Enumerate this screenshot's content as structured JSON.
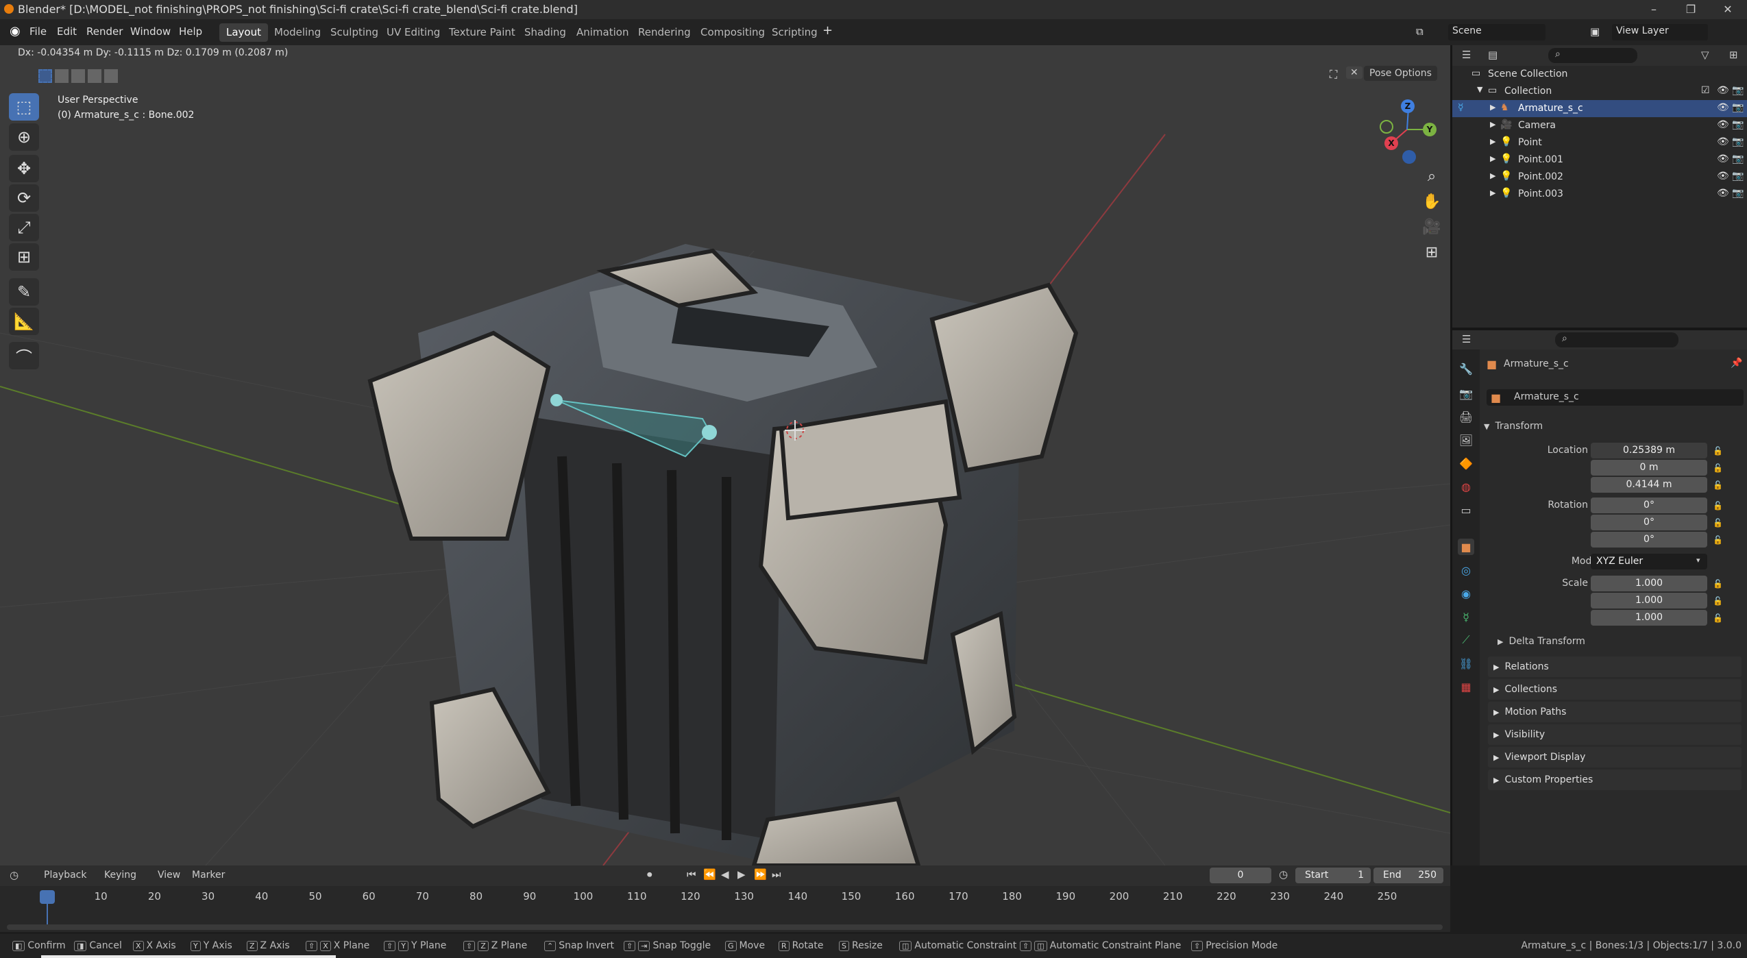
{
  "window": {
    "title": "Blender* [D:\\MODEL_not finishing\\PROPS_not finishing\\Sci-fi crate\\Sci-fi crate_blend\\Sci-fi crate.blend]"
  },
  "menu": [
    "File",
    "Edit",
    "Render",
    "Window",
    "Help"
  ],
  "workspaces": [
    "Layout",
    "Modeling",
    "Sculpting",
    "UV Editing",
    "Texture Paint",
    "Shading",
    "Animation",
    "Rendering",
    "Compositing",
    "Scripting"
  ],
  "scene": {
    "scene_name": "Scene",
    "view_layer": "View Layer"
  },
  "viewport": {
    "delta": "Dx: -0.04354 m   Dy: -0.1115 m   Dz: 0.1709 m (0.2087 m)",
    "perspective": "User Perspective",
    "active": "(0) Armature_s_c : Bone.002",
    "pose_options": "Pose Options"
  },
  "outliner": {
    "scene_collection": "Scene Collection",
    "collection": "Collection",
    "items": [
      "Armature_s_c",
      "Camera",
      "Point",
      "Point.001",
      "Point.002",
      "Point.003"
    ]
  },
  "properties": {
    "object_name": "Armature_s_c",
    "object_field": "Armature_s_c",
    "transform_label": "Transform",
    "location_label": "Location X",
    "location": [
      "0.25389 m",
      "0 m",
      "0.4144 m"
    ],
    "rotation_label": "Rotation X",
    "rotation": [
      "0°",
      "0°",
      "0°"
    ],
    "mode_label": "Mode",
    "mode": "XYZ Euler",
    "scale_label": "Scale X",
    "scale": [
      "1.000",
      "1.000",
      "1.000"
    ],
    "axis_y": "Y",
    "axis_z": "Z",
    "delta_transform": "Delta Transform",
    "sections": [
      "Relations",
      "Collections",
      "Motion Paths",
      "Visibility",
      "Viewport Display",
      "Custom Properties"
    ]
  },
  "timeline": {
    "menus": [
      "Playback",
      "Keying",
      "View",
      "Marker"
    ],
    "current_frame": "0",
    "start_label": "Start",
    "start": "1",
    "end_label": "End",
    "end": "250",
    "ticks": [
      "0",
      "10",
      "20",
      "30",
      "40",
      "50",
      "60",
      "70",
      "80",
      "90",
      "100",
      "110",
      "120",
      "130",
      "140",
      "150",
      "160",
      "170",
      "180",
      "190",
      "200",
      "210",
      "220",
      "230",
      "240",
      "250"
    ]
  },
  "statusbar": {
    "confirm": "Confirm",
    "cancel": "Cancel",
    "x_axis": "X Axis",
    "y_axis": "Y Axis",
    "z_axis": "Z Axis",
    "x_plane": "X Plane",
    "y_plane": "Y Plane",
    "z_plane": "Z Plane",
    "snap_invert": "Snap Invert",
    "snap_toggle": "Snap Toggle",
    "move": "Move",
    "rotate": "Rotate",
    "resize": "Resize",
    "auto_constraint": "Automatic Constraint",
    "auto_constraint_plane": "Automatic Constraint Plane",
    "precision": "Precision Mode",
    "info": "Armature_s_c | Bones:1/3 | Objects:1/7 | 3.0.0"
  },
  "colors": {
    "accent": "#4772b3",
    "selected_row": "#334d80",
    "bone": "#65c3c3",
    "x_axis": "#e04050",
    "y_axis": "#7cb342",
    "z_axis": "#3f7fe0"
  }
}
